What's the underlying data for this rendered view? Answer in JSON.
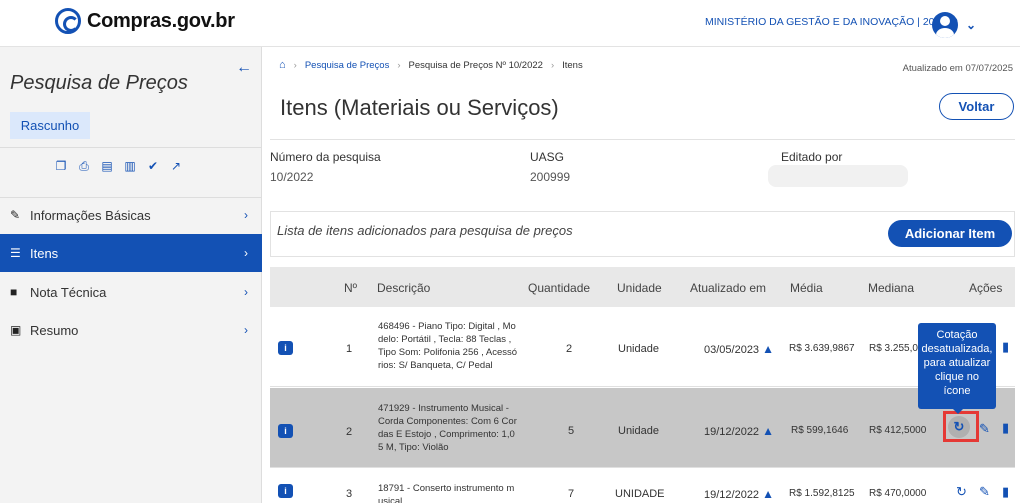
{
  "header": {
    "logo_text": "Compras.gov.br",
    "ministry": "MINISTÉRIO DA GESTÃO E DA INOVAÇÃO | 200999",
    "chevron": "⌄"
  },
  "sidebar": {
    "back": "←",
    "title": "Pesquisa de Preços",
    "badge": "Rascunho",
    "tools": [
      "copy-icon",
      "print-icon",
      "file-download-icon",
      "csv-icon",
      "check-icon",
      "share-icon"
    ],
    "items": [
      {
        "label": "Informações Básicas",
        "icon": "pencil-icon"
      },
      {
        "label": "Itens",
        "icon": "list-icon"
      },
      {
        "label": "Nota Técnica",
        "icon": "file-icon"
      },
      {
        "label": "Resumo",
        "icon": "file-download-icon"
      }
    ]
  },
  "breadcrumb": {
    "items": [
      "Pesquisa de Preços",
      "Pesquisa de Preços Nº 10/2022",
      "Itens"
    ],
    "updated": "Atualizado em 07/07/2025"
  },
  "page": {
    "title": "Itens (Materiais ou Serviços)",
    "back_button": "Voltar",
    "numero_label": "Número da pesquisa",
    "numero_value": "10/2022",
    "uasg_label": "UASG",
    "uasg_value": "200999",
    "editado_label": "Editado por",
    "list_text": "Lista de itens adicionados para pesquisa de preços",
    "add_button": "Adicionar Item"
  },
  "table": {
    "headers": [
      "Nº",
      "Descrição",
      "Quantidade",
      "Unidade",
      "Atualizado em",
      "Média",
      "Mediana",
      "Ações"
    ],
    "rows": [
      {
        "n": "1",
        "desc": [
          "468496 - Piano Tipo: Digital , Mo",
          "delo: Portátil , Tecla: 88 Teclas ,",
          "Tipo Som: Polifonia 256 , Acessó",
          "rios: S/ Banqueta, C/ Pedal"
        ],
        "qtd": "2",
        "unidade": "Unidade",
        "atualizado": "03/05/2023",
        "media": "R$ 3.639,9867",
        "mediana": "R$ 3.255,0"
      },
      {
        "n": "2",
        "desc": [
          "471929 - Instrumento Musical -",
          "Corda Componentes: Com 6 Cor",
          "das E Estojo , Comprimento: 1,0",
          "5 M, Tipo: Violão"
        ],
        "qtd": "5",
        "unidade": "Unidade",
        "atualizado": "19/12/2022",
        "media": "R$ 599,1646",
        "mediana": "R$ 412,5000"
      },
      {
        "n": "3",
        "desc": [
          "18791 - Conserto instrumento m",
          "usical"
        ],
        "qtd": "7",
        "unidade": "UNIDADE",
        "atualizado": "19/12/2022",
        "media": "R$ 1.592,8125",
        "mediana": "R$ 470,0000"
      }
    ],
    "info_badge": "i"
  },
  "tooltip": {
    "lines": [
      "Cotação",
      "desatualizada,",
      "para atualizar",
      "clique no",
      "ícone"
    ]
  }
}
